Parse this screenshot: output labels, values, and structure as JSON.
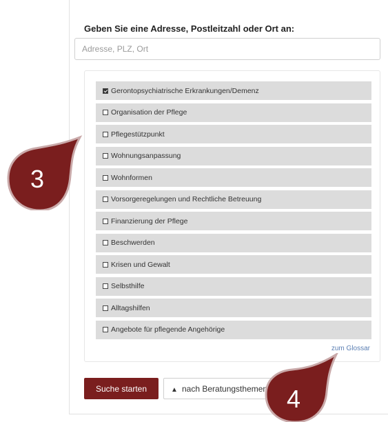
{
  "search": {
    "prompt": "Geben Sie eine Adresse, Postleitzahl oder Ort an:",
    "placeholder": "Adresse, PLZ, Ort"
  },
  "topics": [
    {
      "label": "Gerontopsychiatrische Erkrankungen/Demenz",
      "checked": true
    },
    {
      "label": "Organisation der Pflege",
      "checked": false
    },
    {
      "label": "Pflegestützpunkt",
      "checked": false
    },
    {
      "label": "Wohnungsanpassung",
      "checked": false
    },
    {
      "label": "Wohnformen",
      "checked": false
    },
    {
      "label": "Vorsorgeregelungen und Rechtliche Betreuung",
      "checked": false
    },
    {
      "label": "Finanzierung der Pflege",
      "checked": false
    },
    {
      "label": "Beschwerden",
      "checked": false
    },
    {
      "label": "Krisen und Gewalt",
      "checked": false
    },
    {
      "label": "Selbsthilfe",
      "checked": false
    },
    {
      "label": "Alltagshilfen",
      "checked": false
    },
    {
      "label": "Angebote für pflegende Angehörige",
      "checked": false
    }
  ],
  "glossar_link": "zum Glossar",
  "buttons": {
    "search": "Suche starten",
    "topics": "nach Beratungsthemen"
  },
  "callouts": {
    "left": "3",
    "bottom": "4"
  },
  "colors": {
    "brand": "#7a1e1e",
    "callout": "#8b1a1a",
    "item_bg": "#dcdcdc",
    "link": "#5b7fb3"
  },
  "icons": {
    "checkbox_checked": "checkbox-checked-icon",
    "checkbox_empty": "checkbox-empty-icon",
    "chevron_up": "chevron-up-icon"
  }
}
